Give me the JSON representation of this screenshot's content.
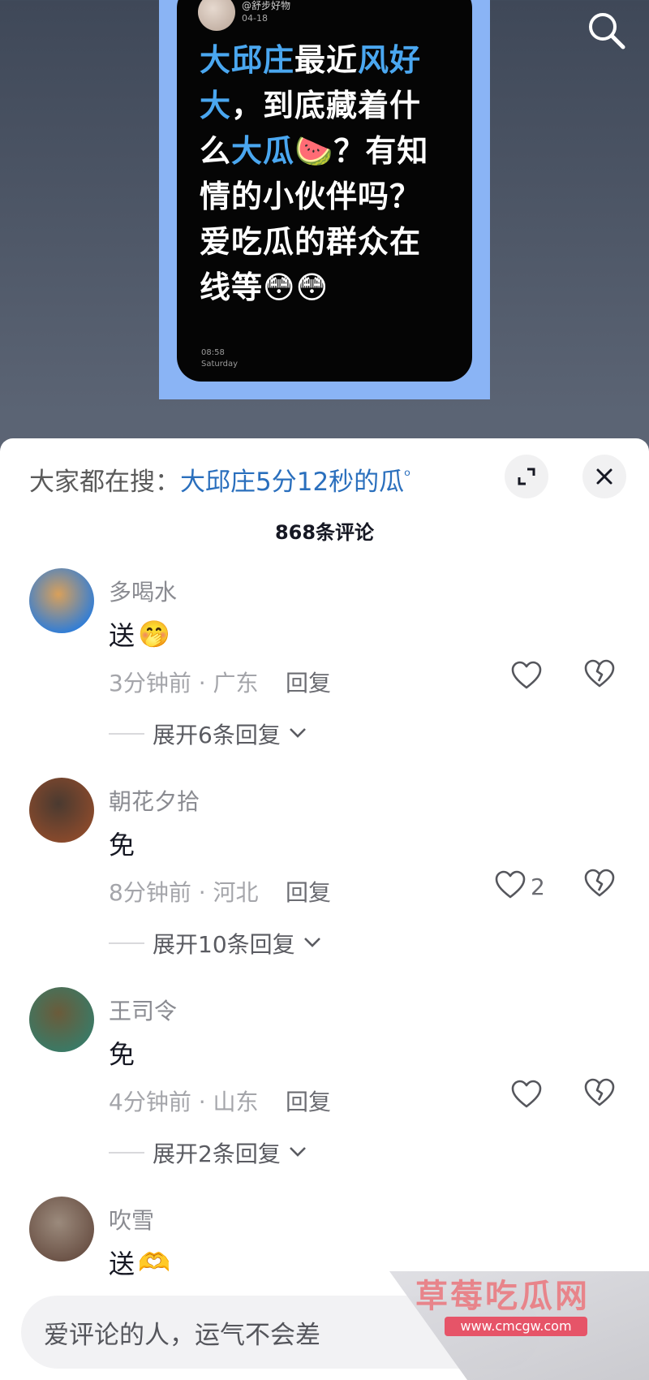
{
  "video": {
    "post_handle": "@舒步好物",
    "post_date": "04-18",
    "post_text_parts": [
      {
        "text": "大邱庄",
        "hl": true
      },
      {
        "text": "最近",
        "hl": false
      },
      {
        "text": "风好大",
        "hl": true
      },
      {
        "text": "，到底藏着什么",
        "hl": false
      },
      {
        "text": "大瓜",
        "hl": true
      },
      {
        "text": "🍉？有知情的小伙伴吗？爱吃瓜的群众在线等😳😳",
        "hl": false
      }
    ],
    "post_clock": "08:58",
    "post_day": "Saturday",
    "search_icon": "search-icon"
  },
  "sheet": {
    "hot_search_prefix": "大家都在搜：",
    "hot_search_term": "大邱庄5分12秒的瓜",
    "hot_search_mag": "ᵒ",
    "comment_count_title": "868条评论",
    "comments": [
      {
        "name": "多喝水",
        "text": "送",
        "emoji": "🤭",
        "meta": "3分钟前 · 广东",
        "reply": "回复",
        "likes": "",
        "expand": "展开6条回复",
        "avatar_colors": [
          "#2f7dd8",
          "#d9a05a"
        ]
      },
      {
        "name": "朝花夕拾",
        "text": "免",
        "emoji": "",
        "meta": "8分钟前 · 河北",
        "reply": "回复",
        "likes": "2",
        "expand": "展开10条回复",
        "avatar_colors": [
          "#8a4a2c",
          "#4a3a30"
        ]
      },
      {
        "name": "王司令",
        "text": "免",
        "emoji": "",
        "meta": "4分钟前 · 山东",
        "reply": "回复",
        "likes": "",
        "expand": "展开2条回复",
        "avatar_colors": [
          "#3a7a66",
          "#6b5b3a"
        ]
      },
      {
        "name": "吹雪",
        "text": "送",
        "emoji": "🫶",
        "meta": "",
        "reply": "",
        "likes": "",
        "expand": "",
        "avatar_colors": [
          "#6b5246",
          "#9b8a7c"
        ]
      }
    ],
    "input_placeholder": "爱评论的人，运气不会差"
  },
  "watermark": {
    "title": "草莓吃瓜网",
    "url": "www.cmcgw.com"
  },
  "colors": {
    "link_blue": "#2a6fbd",
    "post_highlight": "#4aa7f0",
    "watermark_pink": "#e65468"
  }
}
